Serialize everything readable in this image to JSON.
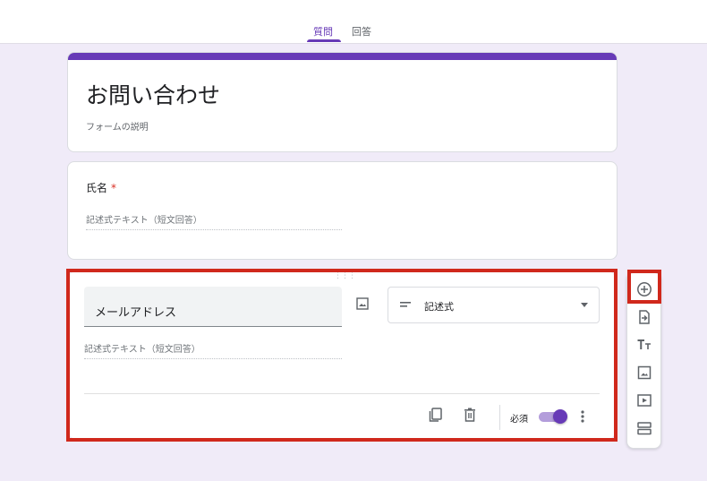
{
  "tabs": [
    {
      "label": "質問",
      "active": true
    },
    {
      "label": "回答",
      "active": false
    }
  ],
  "form": {
    "title": "お問い合わせ",
    "description": "フォームの説明"
  },
  "question1": {
    "label": "氏名",
    "required_mark": "*",
    "answer_placeholder": "記述式テキスト（短文回答）"
  },
  "question2": {
    "title": "メールアドレス",
    "type_label": "記述式",
    "answer_placeholder": "記述式テキスト（短文回答）",
    "required_label": "必須",
    "required": true
  },
  "toolbar": {
    "icons": [
      "add-question-icon",
      "import-questions-icon",
      "add-title-icon",
      "add-image-icon",
      "add-video-icon",
      "add-section-icon"
    ]
  },
  "colors": {
    "accent": "#673ab7",
    "highlight": "#d0281c",
    "background": "#f0ebf8"
  }
}
